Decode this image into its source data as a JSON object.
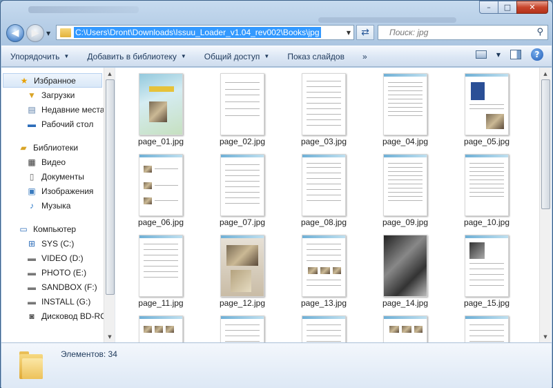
{
  "window": {
    "minimize_label": "–",
    "maximize_label": "□",
    "close_label": "✕"
  },
  "address": {
    "path": "C:\\Users\\Dront\\Downloads\\Issuu_Loader_v1.04_rev002\\Books\\jpg"
  },
  "search": {
    "placeholder": "Поиск: jpg"
  },
  "toolbar": {
    "organize": "Упорядочить",
    "add_to_library": "Добавить в библиотеку",
    "share": "Общий доступ",
    "slideshow": "Показ слайдов",
    "more": "»"
  },
  "nav": {
    "favorites": "Избранное",
    "downloads": "Загрузки",
    "recent": "Недавние места",
    "desktop": "Рабочий стол",
    "libraries": "Библиотеки",
    "video": "Видео",
    "documents": "Документы",
    "images": "Изображения",
    "music": "Музыка",
    "computer": "Компьютер",
    "drives": [
      "SYS (C:)",
      "VIDEO (D:)",
      "PHOTO (E:)",
      "SANDBOX (F:)",
      "INSTALL (G:)",
      "Дисковод BD-RO"
    ]
  },
  "files": [
    "page_01.jpg",
    "page_02.jpg",
    "page_03.jpg",
    "page_04.jpg",
    "page_05.jpg",
    "page_06.jpg",
    "page_07.jpg",
    "page_08.jpg",
    "page_09.jpg",
    "page_10.jpg",
    "page_11.jpg",
    "page_12.jpg",
    "page_13.jpg",
    "page_14.jpg",
    "page_15.jpg"
  ],
  "details": {
    "count": "Элементов: 34"
  },
  "colors": {
    "selection": "#3399ff",
    "frame": "#b9d0e8"
  }
}
